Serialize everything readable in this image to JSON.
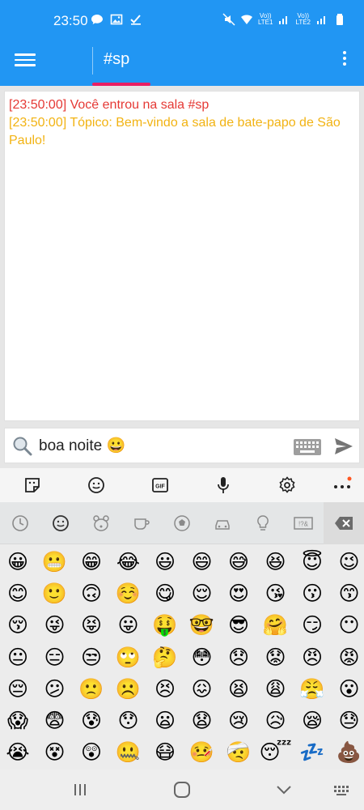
{
  "status_bar": {
    "time": "23:50",
    "left_icons": [
      "chat-bubble-icon",
      "image-icon",
      "check-icon"
    ],
    "sim1_label_top": "Vo))",
    "sim1_label_bottom": "LTE1",
    "sim2_label_top": "Vo))",
    "sim2_label_bottom": "LTE2"
  },
  "app_bar": {
    "tab_label": "#sp",
    "accent": "#e91e63",
    "bg": "#2196f3"
  },
  "chat": {
    "messages": [
      {
        "text": "[23:50:00] Você entrou na sala #sp",
        "color": "#e53935"
      },
      {
        "text": "[23:50:00] Tópico: Bem-vindo a sala de bate-papo de São Paulo!",
        "color": "#f2b313"
      }
    ]
  },
  "input": {
    "value": "boa noite 😀"
  },
  "keyboard_toolbar": {
    "gif_label": "GIF",
    "tools": [
      "sticker-icon",
      "emoji-icon",
      "gif-icon",
      "microphone-icon",
      "settings-icon",
      "more-icon"
    ]
  },
  "emoji_categories": {
    "items": [
      "recent-icon",
      "smiley-icon",
      "animal-icon",
      "food-icon",
      "sport-icon",
      "travel-icon",
      "object-icon",
      "symbol-icon"
    ],
    "symbol_label": "!?&",
    "backspace": "backspace-icon"
  },
  "emoji_rows": [
    [
      "😀",
      "😬",
      "😁",
      "😂",
      "😃",
      "😄",
      "😅",
      "😆",
      "😇",
      "😉"
    ],
    [
      "😊",
      "🙂",
      "🙃",
      "☺️",
      "😋",
      "😌",
      "😍",
      "😘",
      "😗",
      "😙"
    ],
    [
      "😚",
      "😜",
      "😝",
      "😛",
      "🤑",
      "🤓",
      "😎",
      "🤗",
      "😏",
      "😶"
    ],
    [
      "😐",
      "😑",
      "😒",
      "🙄",
      "🤔",
      "😳",
      "😞",
      "😟",
      "😠",
      "😡"
    ],
    [
      "😔",
      "😕",
      "🙁",
      "☹️",
      "😣",
      "😖",
      "😫",
      "😩",
      "😤",
      "😮"
    ],
    [
      "😱",
      "😨",
      "😰",
      "😯",
      "😦",
      "😧",
      "😢",
      "😥",
      "😪",
      "😓"
    ],
    [
      "😭",
      "😵",
      "😲",
      "🤐",
      "😷",
      "🤒",
      "🤕",
      "😴",
      "💤",
      "💩"
    ]
  ],
  "nav_bar": {
    "buttons": [
      "recent-apps-icon",
      "home-icon",
      "back-icon",
      "keyboard-switch-icon"
    ]
  }
}
